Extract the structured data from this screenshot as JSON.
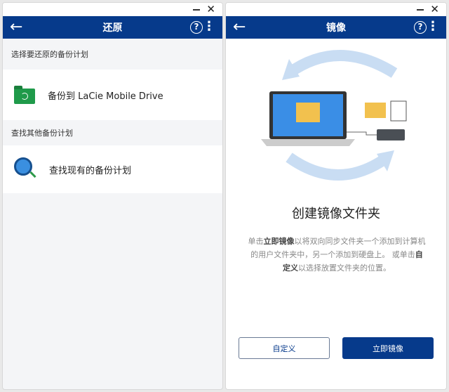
{
  "left": {
    "title": "还原",
    "section1": "选择要还原的备份计划",
    "item1": "备份到 LaCie Mobile Drive",
    "section2": "查找其他备份计划",
    "item2": "查找现有的备份计划"
  },
  "right": {
    "title": "镜像",
    "heading": "创建镜像文件夹",
    "desc": {
      "p1": "单击",
      "b1": "立即镜像",
      "p2": "以将双向同步文件夹一个添加到计算机的用户文件夹中，另一个添加到硬盘上。 或单击",
      "b2": "自定义",
      "p3": "以选择放置文件夹的位置。"
    },
    "custom_button": "自定义",
    "mirror_button": "立即镜像"
  },
  "controls": {
    "minimize": "—",
    "close": "✕",
    "back": "←",
    "help": "?",
    "more": "⋮"
  },
  "colors": {
    "accent": "#063a8b"
  }
}
